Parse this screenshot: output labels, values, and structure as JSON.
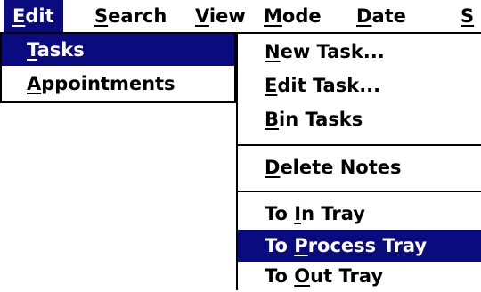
{
  "menubar": {
    "items": [
      {
        "pre": "",
        "key": "E",
        "post": "dit"
      },
      {
        "pre": "",
        "key": "S",
        "post": "earch"
      },
      {
        "pre": "",
        "key": "V",
        "post": "iew"
      },
      {
        "pre": "",
        "key": "M",
        "post": "ode"
      },
      {
        "pre": "",
        "key": "D",
        "post": "ate"
      },
      {
        "pre": "",
        "key": "S",
        "post": ""
      }
    ]
  },
  "edit_menu": {
    "items": [
      {
        "pre": "",
        "key": "T",
        "post": "asks"
      },
      {
        "pre": "",
        "key": "A",
        "post": "ppointments"
      }
    ]
  },
  "tasks_submenu": {
    "items": [
      {
        "pre": "",
        "key": "N",
        "post": "ew Task..."
      },
      {
        "pre": "",
        "key": "E",
        "post": "dit Task..."
      },
      {
        "pre": "",
        "key": "B",
        "post": "in Tasks"
      },
      {
        "pre": "",
        "key": "D",
        "post": "elete Notes"
      },
      {
        "pre": "To ",
        "key": "I",
        "post": "n Tray"
      },
      {
        "pre": "To ",
        "key": "P",
        "post": "rocess Tray"
      },
      {
        "pre": "To ",
        "key": "O",
        "post": "ut Tray"
      }
    ]
  },
  "colors": {
    "highlight": "#0b0b80",
    "highlight_text": "#ffffff",
    "background": "#ffffff"
  }
}
